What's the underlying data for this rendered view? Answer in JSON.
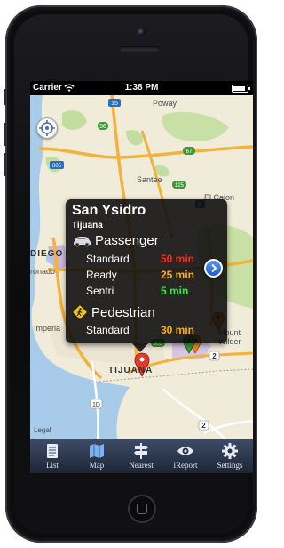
{
  "status_bar": {
    "carrier": "Carrier",
    "time": "1:38 PM"
  },
  "map": {
    "places": [
      "Poway",
      "Santee",
      "El Cajon",
      "DIEGO",
      "ronado",
      "Imperia",
      "Mount Wilder",
      "TIJUANA",
      "Legal"
    ],
    "highways": [
      "15",
      "56",
      "805",
      "125",
      "8",
      "67",
      "905",
      "2",
      "1D",
      "2"
    ]
  },
  "popup": {
    "title": "San Ysidro",
    "subtitle": "Tijuana",
    "lanes": [
      {
        "name": "Passenger",
        "icon": "car-icon",
        "rows": [
          {
            "label": "Standard",
            "time": "50 min",
            "status": "red"
          },
          {
            "label": "Ready",
            "time": "25 min",
            "status": "orange"
          },
          {
            "label": "Sentri",
            "time": "5 min",
            "status": "green"
          }
        ]
      },
      {
        "name": "Pedestrian",
        "icon": "pedestrian-icon",
        "rows": [
          {
            "label": "Standard",
            "time": "30 min",
            "status": "orange"
          }
        ]
      }
    ]
  },
  "tabbar": {
    "items": [
      {
        "label": "List",
        "icon": "list-icon"
      },
      {
        "label": "Map",
        "icon": "map-icon"
      },
      {
        "label": "Nearest",
        "icon": "signpost-icon"
      },
      {
        "label": "iReport",
        "icon": "eye-icon"
      },
      {
        "label": "Settings",
        "icon": "gear-icon"
      }
    ]
  },
  "colors": {
    "red": "#ff2a1a",
    "orange": "#ffae0d",
    "green": "#38e843",
    "tabbar": "#2a3448"
  }
}
